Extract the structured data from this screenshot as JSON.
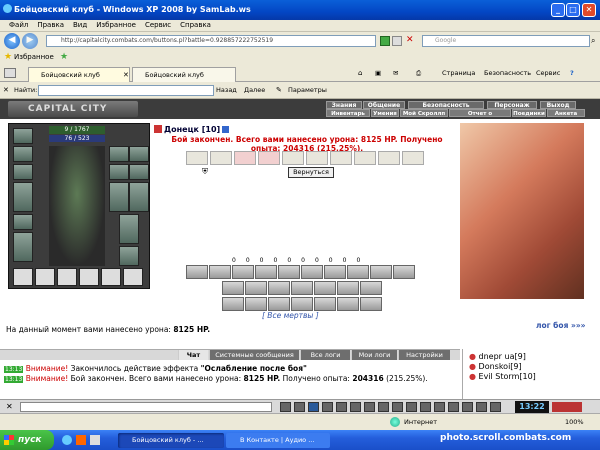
{
  "window": {
    "title": "Бойцовский клуб - Windows XP 2008 by SamLab.ws",
    "icon": "ie-icon"
  },
  "menu": [
    "Файл",
    "Правка",
    "Вид",
    "Избранное",
    "Сервис",
    "Справка"
  ],
  "address": {
    "url": "http://capitalcity.combats.com/buttons.pl?battle=0.928857222752519",
    "search_placeholder": "Google"
  },
  "favorites": {
    "label": "Избранное"
  },
  "tabs": [
    "Бойцовский клуб",
    "Бойцовский клуб"
  ],
  "ie_menu": [
    "Страница",
    "Безопасность",
    "Сервис"
  ],
  "findbar": {
    "label": "Найти:",
    "prev": "Назад",
    "next": "Далее",
    "options": "Параметры"
  },
  "game": {
    "logo": "CAPITAL CITY",
    "top_nav": [
      "Знания",
      "Общение",
      "Безопасность",
      "Персонаж",
      "Выход"
    ],
    "sub_nav": [
      "Инвентарь",
      "Умения",
      "Мой Скроллп",
      "Отчет о переводах",
      "Поединки",
      "Анкета"
    ],
    "hp": "9 / 1767",
    "mp": "76 / 523",
    "player": "Донецк [10]",
    "battle_msg": "Бой закончен. Всего вами нанесено урона: 8125 HP. Получено опыта: 204316 (215.25%).",
    "back_button": "Вернуться",
    "tech_counts": [
      "0",
      "0",
      "0",
      "0",
      "0",
      "0",
      "0",
      "0",
      "0",
      "0"
    ],
    "dead_link": "[ Все мертвы ]",
    "damage_label": "На данный момент вами нанесено урона:",
    "damage_value": "8125 HP.",
    "log_link": "лог боя »»»"
  },
  "chat": {
    "tabs": [
      "Чат",
      "Системные сообщения",
      "Все логи",
      "Мои логи",
      "Настройки"
    ],
    "messages": [
      {
        "time": "13:13",
        "warn": "Внимание!",
        "text": "Закончилось действие эффекта",
        "bold": "\"Ослабление после боя\""
      },
      {
        "time": "13:13",
        "warn": "Внимание!",
        "text": "Бой закончен. Всего вами нанесено урона:",
        "bold": "8125 HP.",
        "text2": "Получено опыта:",
        "bold2": "204316",
        "tail": "(215.25%)."
      }
    ],
    "users": [
      "dnepr ua[9]",
      "Donskoi[9]",
      "Evil Storm[10]"
    ]
  },
  "clock": "13:22",
  "status": {
    "zone": "Интернет",
    "zoom": "100%"
  },
  "taskbar": {
    "start": "пуск",
    "items": [
      "Бойцовский клуб - ...",
      "В Контакте | Аудио ..."
    ],
    "watermark": "photo.scroll.combats.com"
  }
}
